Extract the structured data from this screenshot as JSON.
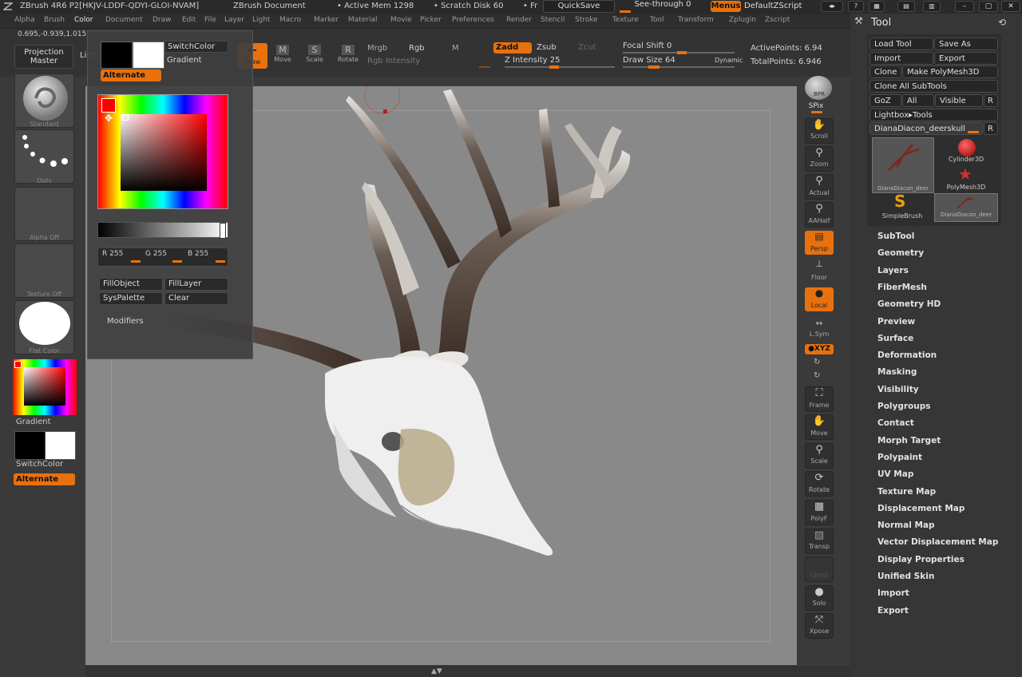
{
  "titlebar": {
    "app_title": "ZBrush 4R6 P2[HKJV-LDDF-QDYI-GLOI-NVAM]",
    "document": "ZBrush Document",
    "active_mem": "• Active Mem 1298",
    "scratch_disk": "• Scratch Disk 60",
    "fr": "• Fr",
    "quicksave": "QuickSave",
    "see_through": "See-through  0",
    "menus": "Menus",
    "default_zscript": "DefaultZScript"
  },
  "menubar": {
    "items": [
      "Alpha",
      "Brush",
      "Color",
      "Document",
      "Draw",
      "Edit",
      "File",
      "Layer",
      "Light",
      "Macro",
      "Marker",
      "Material",
      "Movie",
      "Picker",
      "Preferences",
      "Render",
      "Stencil",
      "Stroke",
      "Texture",
      "Tool",
      "Transform",
      "Zplugin",
      "Zscript"
    ]
  },
  "coords": "0.695,-0.939,1.015",
  "toolshelf": {
    "projection_master": "Projection\nMaster",
    "lightbox_partial": "Ligh",
    "draw": "Draw",
    "move": "Move",
    "scale": "Scale",
    "rotate": "Rotate",
    "mrgb": "Mrgb",
    "rgb": "Rgb",
    "m": "M",
    "rgb_intensity": "Rgb Intensity",
    "zadd": "Zadd",
    "zsub": "Zsub",
    "zcut": "Zcut",
    "z_intensity": "Z Intensity 25",
    "focal_shift": "Focal Shift 0",
    "draw_size": "Draw Size 64",
    "dynamic": "Dynamic",
    "active_points": "ActivePoints: 6.94",
    "total_points": "TotalPoints: 6.946"
  },
  "color_popup": {
    "switch_color": "SwitchColor",
    "gradient": "Gradient",
    "alternate": "Alternate",
    "r_value": "R 255",
    "g_value": "G 255",
    "b_value": "B 255",
    "fill_object": "FillObject",
    "fill_layer": "FillLayer",
    "sys_palette": "SysPalette",
    "clear": "Clear",
    "modifiers": "Modifiers"
  },
  "left_shelf": {
    "standard": "Standard",
    "dots": "Dots",
    "alpha_off": "Alpha  Off",
    "texture_off": "Texture  Off",
    "flat_color": "Flat Color",
    "gradient": "Gradient",
    "switch_color": "SwitchColor",
    "alternate": "Alternate"
  },
  "right_shelf": {
    "bpr": "BPR",
    "spix": "SPix",
    "scroll": "Scroll",
    "zoom": "Zoom",
    "actual": "Actual",
    "aahalf": "AAHalf",
    "persp": "Persp",
    "floor": "Floor",
    "local": "Local",
    "lsym": "L.Sym",
    "xyz": "●XYZ",
    "frame": "Frame",
    "move": "Move",
    "scale": "Scale",
    "rotate": "Rotate",
    "polyf": "PolyF",
    "transp": "Transp",
    "ghost": "Ghost",
    "solo": "Solo",
    "xpose": "Xpose"
  },
  "tool_panel": {
    "title": "Tool",
    "load_tool": "Load Tool",
    "save_as": "Save As",
    "import": "Import",
    "export": "Export",
    "clone": "Clone",
    "make_polymesh": "Make PolyMesh3D",
    "clone_all": "Clone  All SubTools",
    "goz": "GoZ",
    "all": "All",
    "visible": "Visible",
    "r": "R",
    "lightbox_tools": "Lightbox▸Tools",
    "current_tool": "DianaDiacon_deerskull",
    "thumbs": {
      "t1": "DianaDiacon_deer",
      "t2": "Cylinder3D",
      "t3": "PolyMesh3D",
      "t4": "SimpleBrush",
      "t5": "DianaDiacon_deer"
    },
    "sections": [
      "SubTool",
      "Geometry",
      "Layers",
      "FiberMesh",
      "Geometry HD",
      "Preview",
      "Surface",
      "Deformation",
      "Masking",
      "Visibility",
      "Polygroups",
      "Contact",
      "Morph Target",
      "Polypaint",
      "UV Map",
      "Texture Map",
      "Displacement Map",
      "Normal Map",
      "Vector Displacement Map",
      "Display Properties",
      "Unified Skin",
      "Import",
      "Export"
    ]
  },
  "colors": {
    "accent": "#e8710e",
    "canvas": "#898989",
    "panel": "#363636"
  }
}
